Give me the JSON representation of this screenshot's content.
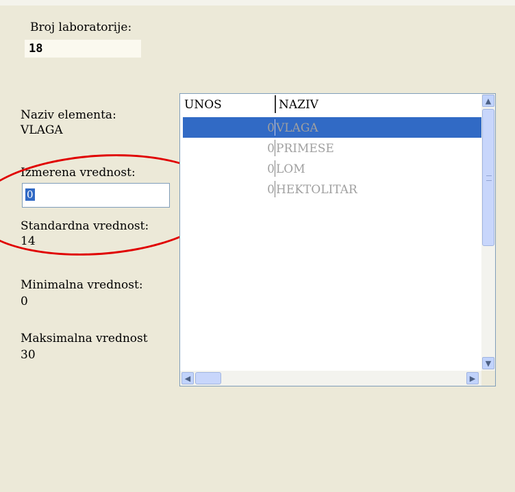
{
  "form": {
    "lab_label": "Broj laboratorije:",
    "lab_value": "18",
    "element_name_label": "Naziv elementa:",
    "element_name_value": "VLAGA",
    "measured_label": "Izmerena vrednost:",
    "measured_value": "0",
    "standard_label": "Standardna vrednost:",
    "standard_value": "14",
    "min_label": "Minimalna vrednost:",
    "min_value": "0",
    "max_label": "Maksimalna vrednost",
    "max_value": "30"
  },
  "grid": {
    "columns": [
      "UNOS",
      "NAZIV"
    ],
    "rows": [
      {
        "unos": "0",
        "naziv": "VLAGA",
        "selected": true
      },
      {
        "unos": "0",
        "naziv": "PRIMESE",
        "selected": false
      },
      {
        "unos": "0",
        "naziv": "LOM",
        "selected": false
      },
      {
        "unos": "0",
        "naziv": "HEKTOLITAR",
        "selected": false
      }
    ]
  },
  "colors": {
    "background": "#ece9d8",
    "selection": "#316ac5",
    "annotation": "#e00000"
  }
}
